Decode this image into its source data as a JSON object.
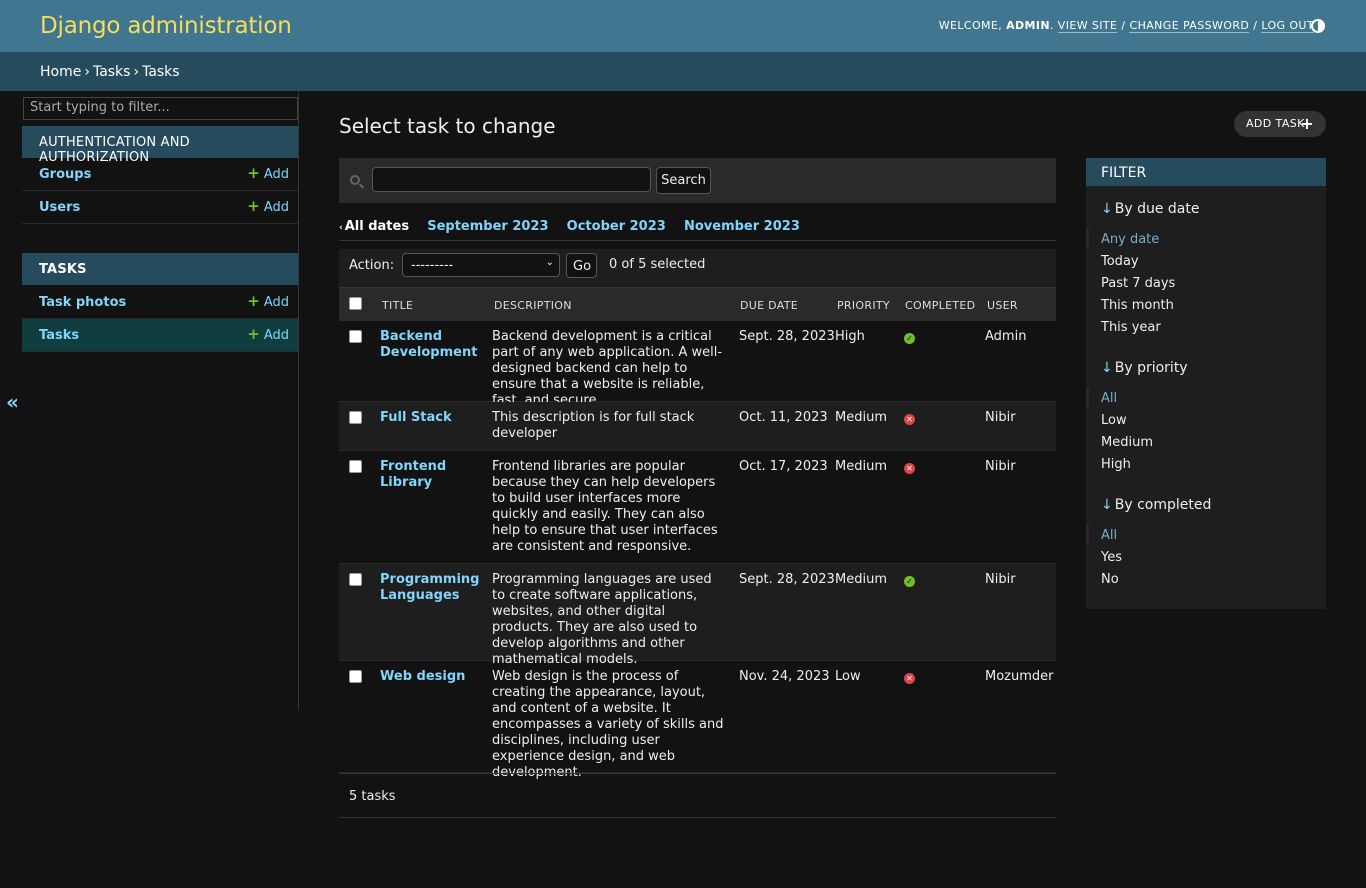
{
  "header": {
    "site_name": "Django administration",
    "welcome": "Welcome,",
    "username": "Admin",
    "view_site": "View site",
    "change_password": "Change password",
    "log_out": "Log out"
  },
  "breadcrumbs": [
    "Home",
    "Tasks",
    "Tasks"
  ],
  "sidebar": {
    "filter_placeholder": "Start typing to filter...",
    "apps": [
      {
        "caption": "Authentication and Authorization",
        "models": [
          {
            "name": "Groups",
            "add": "Add"
          },
          {
            "name": "Users",
            "add": "Add"
          }
        ]
      },
      {
        "caption": "Tasks",
        "models": [
          {
            "name": "Task photos",
            "add": "Add"
          },
          {
            "name": "Tasks",
            "add": "Add",
            "current": true
          }
        ]
      }
    ],
    "toggle_label": "«"
  },
  "content": {
    "title": "Select task to change",
    "add_button": "Add task",
    "search_button": "Search",
    "search_value": "",
    "date_hierarchy": {
      "back": "All dates",
      "months": [
        "September 2023",
        "October 2023",
        "November 2023"
      ]
    },
    "actions": {
      "label": "Action:",
      "selected_option": "---------",
      "go": "Go",
      "counter": "0 of 5 selected"
    },
    "columns": [
      "Title",
      "Description",
      "Due date",
      "Priority",
      "Completed",
      "User"
    ],
    "rows": [
      {
        "title": "Backend Development",
        "description": "Backend development is a critical part of any web application. A well-designed backend can help to ensure that a website is reliable, fast, and secure.",
        "due_date": "Sept. 28, 2023",
        "priority": "High",
        "completed": true,
        "user": "Admin"
      },
      {
        "title": "Full Stack",
        "description": "This description is for full stack developer",
        "due_date": "Oct. 11, 2023",
        "priority": "Medium",
        "completed": false,
        "user": "Nibir"
      },
      {
        "title": "Frontend Library",
        "description": "Frontend libraries are popular because they can help developers to build user interfaces more quickly and easily. They can also help to ensure that user interfaces are consistent and responsive.",
        "due_date": "Oct. 17, 2023",
        "priority": "Medium",
        "completed": false,
        "user": "Nibir"
      },
      {
        "title": "Programming Languages",
        "description": "Programming languages are used to create software applications, websites, and other digital products. They are also used to develop algorithms and other mathematical models.",
        "due_date": "Sept. 28, 2023",
        "priority": "Medium",
        "completed": true,
        "user": "Nibir"
      },
      {
        "title": "Web design",
        "description": "Web design is the process of creating the appearance, layout, and content of a website. It encompasses a variety of skills and disciplines, including user experience design, and web development.",
        "due_date": "Nov. 24, 2023",
        "priority": "Low",
        "completed": false,
        "user": "Mozumder"
      }
    ],
    "paginator": "5 tasks"
  },
  "filter": {
    "title": "Filter",
    "groups": [
      {
        "heading": "By due date",
        "choices": [
          "Any date",
          "Today",
          "Past 7 days",
          "This month",
          "This year"
        ],
        "selected": 0
      },
      {
        "heading": "By priority",
        "choices": [
          "All",
          "Low",
          "Medium",
          "High"
        ],
        "selected": 0
      },
      {
        "heading": "By completed",
        "choices": [
          "All",
          "Yes",
          "No"
        ],
        "selected": 0
      }
    ]
  },
  "colors": {
    "header_bg": "#417690",
    "breadcrumb_bg": "#264b5d",
    "site_name": "#f5dd5d",
    "link": "#81d4fa",
    "yes_icon": "#70bf2b",
    "no_icon": "#dd4646"
  }
}
